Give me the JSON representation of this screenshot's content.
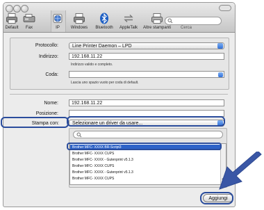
{
  "toolbar": {
    "items": [
      {
        "label": "Default",
        "icon": "printer-icon"
      },
      {
        "label": "Fax",
        "icon": "fax-icon"
      },
      {
        "label": "IP",
        "icon": "globe-icon"
      },
      {
        "label": "Windows",
        "icon": "printer-icon"
      },
      {
        "label": "Bluetooth",
        "icon": "bluetooth-icon"
      },
      {
        "label": "AppleTalk",
        "icon": "appletalk-icon"
      },
      {
        "label": "Altre stampanti",
        "icon": "printer-icon"
      }
    ],
    "search_label": "Cerca"
  },
  "form": {
    "protocol_label": "Protocollo:",
    "protocol_value": "Line Printer Daemon – LPD",
    "address_label": "Indirizzo:",
    "address_value": "192.168.11.22",
    "address_hint": "Indirizzo valido e completo.",
    "queue_label": "Coda:",
    "queue_value": "",
    "queue_hint": "Lascia uno spazio vuoto per coda di default."
  },
  "details": {
    "name_label": "Nome:",
    "name_value": "192.168.11.22",
    "position_label": "Posizione:",
    "position_value": "",
    "print_with_label": "Stampa con:",
    "print_with_value": "Selezionare un driver da usare..."
  },
  "driver_list": {
    "rows": [
      "Brother MFC- XXXX BR-Script3",
      "Brother MFC- XXXX CUPS",
      "Brother MFC- XXXX - Gutenprint v5.1.3",
      "Brother MFC- XXXX CUPS",
      "Brother MFC- XXXX - Gutenprint v5.1.3",
      "Brother MFC- XXXX CUPS"
    ],
    "selected_index": 0
  },
  "add_button": "Aggiungi",
  "colors": {
    "accent": "#2e63c8",
    "callout": "#2a4c9c",
    "arrow": "#3a57a6"
  }
}
